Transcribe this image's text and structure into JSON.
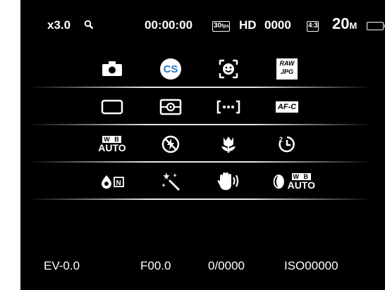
{
  "status_bar": {
    "zoom": "x3.0",
    "timecode": "00:00:00",
    "fps": "30fps",
    "quality": "HD",
    "shot_count": "0000",
    "aspect_ratio": "4:3",
    "megapixels": "20",
    "megapixels_unit": "M"
  },
  "menu": {
    "row1": {
      "cs_label": "CS",
      "raw_label": "RAW",
      "jpg_label": "JPG"
    },
    "row2": {
      "af_label": "AF-C"
    },
    "row3": {
      "wb_label": "W B",
      "wb_auto": "AUTO",
      "timer_label": "2"
    },
    "row4": {
      "flash_label": "N",
      "wb2_label": "W B",
      "wb2_auto": "AUTO"
    }
  },
  "bottom_bar": {
    "ev": "EV-0.0",
    "fnum": "F00.0",
    "shutter": "0/0000",
    "iso": "ISO00000"
  },
  "icons": [
    "magnifier-icon",
    "camera-icon",
    "cs-icon",
    "face-detect-icon",
    "raw-jpg-icon",
    "frame-icon",
    "metering-icon",
    "af-area-icon",
    "af-mode-icon",
    "white-balance-icon",
    "flash-off-icon",
    "macro-icon",
    "self-timer-icon",
    "flash-mode-icon",
    "art-filter-icon",
    "stabilizer-icon",
    "wb-bracket-icon"
  ]
}
